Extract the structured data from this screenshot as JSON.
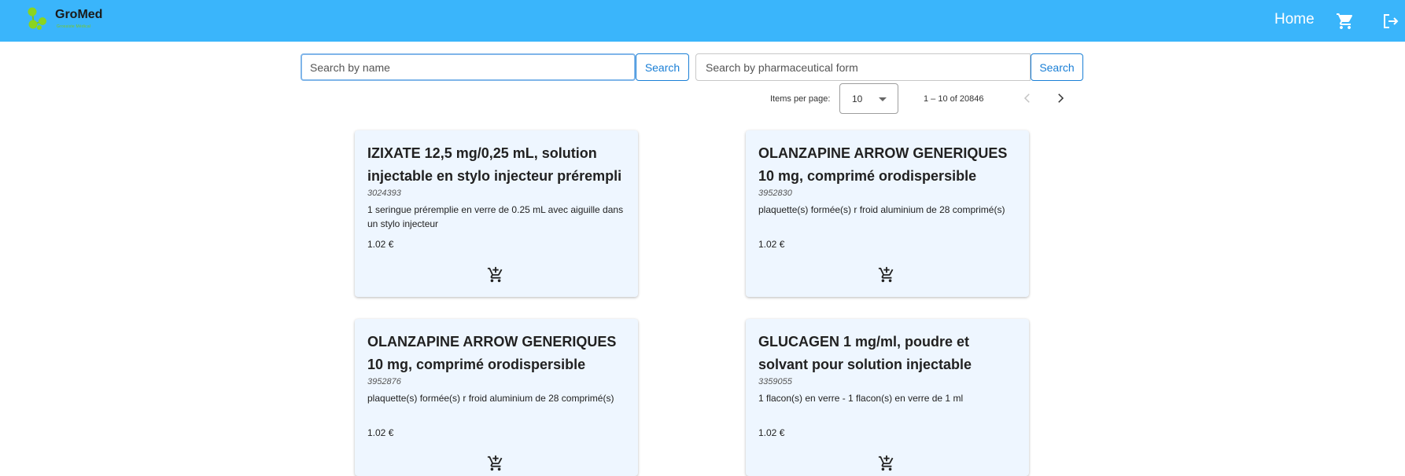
{
  "app": {
    "name": "GroMed",
    "tagline": "Grossiste Médical",
    "nav": {
      "home": "Home"
    }
  },
  "search": {
    "name_placeholder": "Search by name",
    "name_button": "Search",
    "form_placeholder": "Search by pharmaceutical form",
    "form_button": "Search"
  },
  "paginator": {
    "items_per_page_label": "Items per page:",
    "items_per_page": "10",
    "range": "1 – 10 of 20846"
  },
  "products": [
    {
      "title": "IZIXATE 12,5 mg/0,25 mL, solution injectable en stylo injecteur prérempli",
      "code": "3024393",
      "description": "1 seringue préremplie en verre de 0.25 mL avec aiguille dans un stylo injecteur",
      "price": "1.02 €"
    },
    {
      "title": "OLANZAPINE ARROW GENERIQUES 10 mg, comprimé orodispersible",
      "code": "3952830",
      "description": "plaquette(s) formée(s) r froid aluminium de 28 comprimé(s)",
      "price": "1.02 €"
    },
    {
      "title": "OLANZAPINE ARROW GENERIQUES 10 mg, comprimé orodispersible",
      "code": "3952876",
      "description": "plaquette(s) formée(s) r froid aluminium de 28 comprimé(s)",
      "price": "1.02 €"
    },
    {
      "title": "GLUCAGEN 1 mg/ml, poudre et solvant pour solution injectable",
      "code": "3359055",
      "description": "1 flacon(s) en verre - 1 flacon(s) en verre de 1 ml",
      "price": "1.02 €"
    }
  ],
  "icons": {
    "logo": "molecule-logo-icon",
    "cart": "shopping-cart-icon",
    "logout": "logout-icon",
    "prev": "chevron-left-icon",
    "next": "chevron-right-icon",
    "add_to_cart": "add-shopping-cart-icon"
  },
  "colors": {
    "header": "#3ab5fb",
    "accent": "#1a7fd6",
    "card": "#eef6ff",
    "logo_green": "#79c720"
  }
}
